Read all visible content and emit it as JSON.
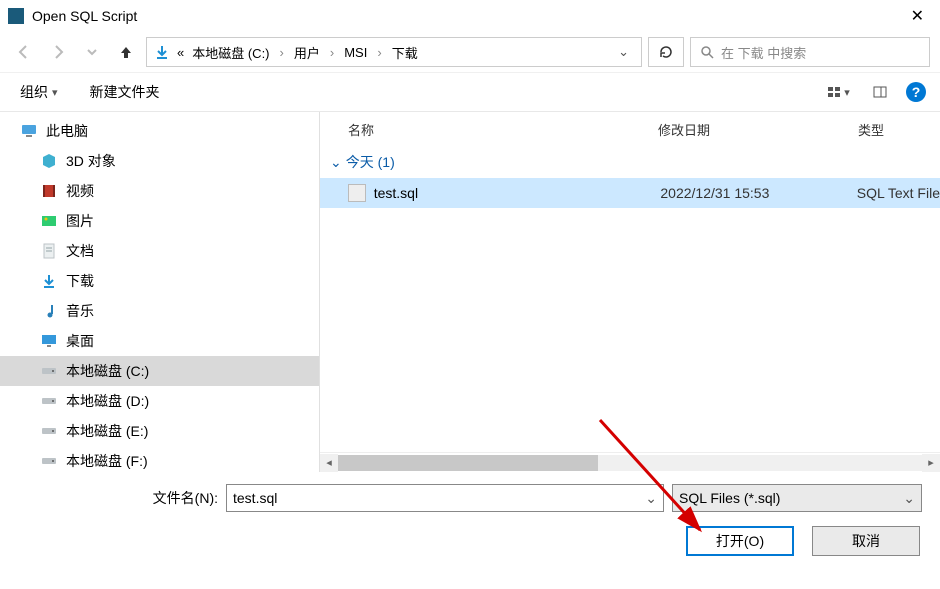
{
  "window": {
    "title": "Open SQL Script"
  },
  "breadcrumb": {
    "prefix": "«",
    "items": [
      "本地磁盘 (C:)",
      "用户",
      "MSI",
      "下载"
    ]
  },
  "search": {
    "placeholder": "在 下载 中搜索"
  },
  "toolbar": {
    "organize": "组织",
    "new_folder": "新建文件夹"
  },
  "sidebar": {
    "this_pc": "此电脑",
    "items": [
      {
        "label": "3D 对象"
      },
      {
        "label": "视频"
      },
      {
        "label": "图片"
      },
      {
        "label": "文档"
      },
      {
        "label": "下载"
      },
      {
        "label": "音乐"
      },
      {
        "label": "桌面"
      },
      {
        "label": "本地磁盘 (C:)",
        "selected": true
      },
      {
        "label": "本地磁盘 (D:)"
      },
      {
        "label": "本地磁盘 (E:)"
      },
      {
        "label": "本地磁盘 (F:)"
      }
    ]
  },
  "columns": {
    "name": "名称",
    "date": "修改日期",
    "type": "类型"
  },
  "group": {
    "label": "今天 (1)"
  },
  "files": [
    {
      "name": "test.sql",
      "date": "2022/12/31 15:53",
      "type": "SQL Text File",
      "selected": true
    }
  ],
  "footer": {
    "filename_label": "文件名(N):",
    "filename_value": "test.sql",
    "filetype_value": "SQL Files (*.sql)",
    "open": "打开(O)",
    "cancel": "取消"
  }
}
